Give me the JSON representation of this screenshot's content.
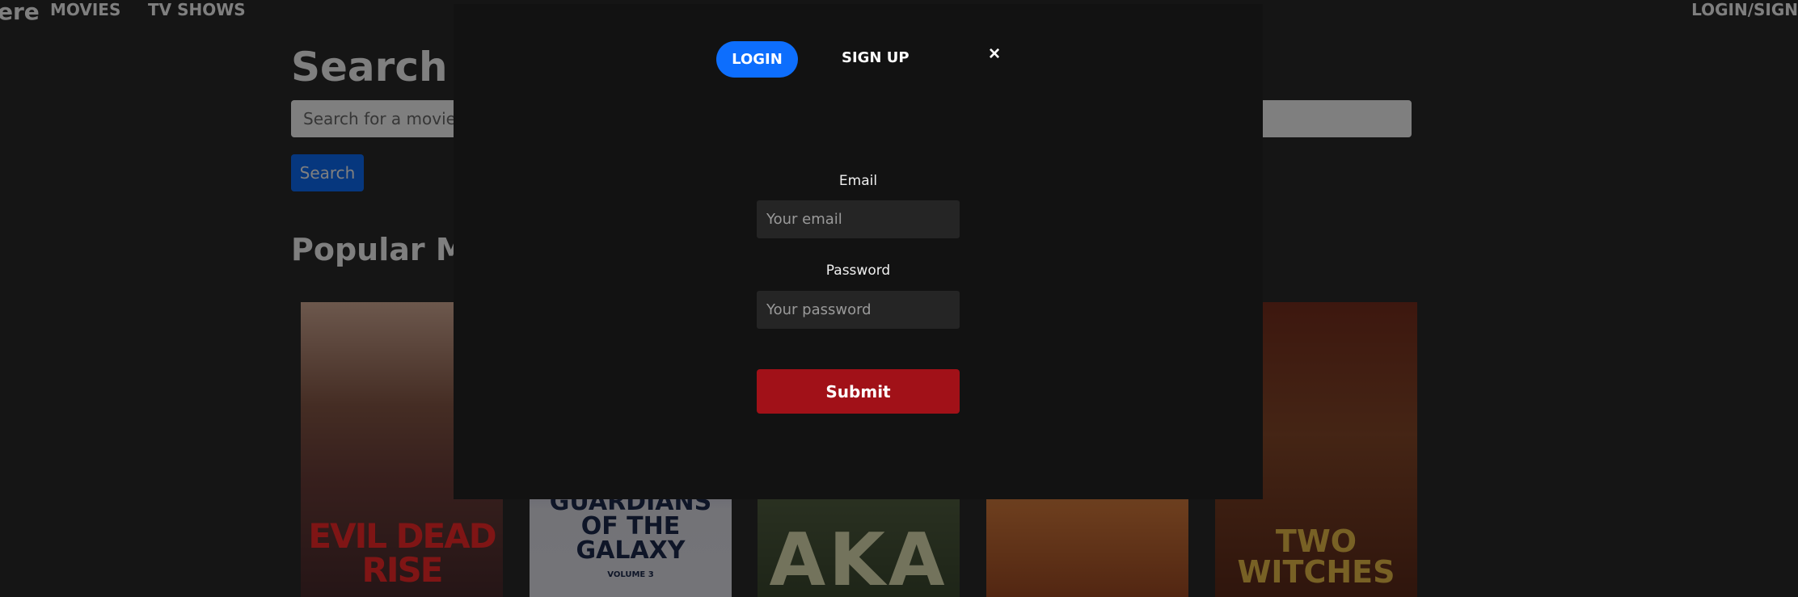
{
  "navbar": {
    "brand": "ere",
    "links": {
      "movies": "MOVIES",
      "tv_shows": "TV SHOWS",
      "login_signup": "LOGIN/SIGN"
    }
  },
  "main": {
    "title": "Search fo",
    "search": {
      "placeholder": "Search for a movie",
      "button_label": "Search"
    },
    "popular_title": "Popular Mo",
    "posters": [
      {
        "title": "EVIL DEAD RISE"
      },
      {
        "title": "GUARDIANS OF THE GALAXY",
        "subtitle": "VOLUME 3"
      },
      {
        "title": "AKA"
      },
      {
        "title": ""
      },
      {
        "title": "TWO WITCHES"
      }
    ]
  },
  "modal": {
    "tabs": {
      "login": "LOGIN",
      "signup": "SIGN UP"
    },
    "close_glyph": "×",
    "email_label": "Email",
    "email_placeholder": "Your email",
    "password_label": "Password",
    "password_placeholder": "Your password",
    "submit_label": "Submit"
  },
  "colors": {
    "primary": "#0d6efd",
    "submit": "#a11118",
    "modal_bg": "#121212"
  }
}
